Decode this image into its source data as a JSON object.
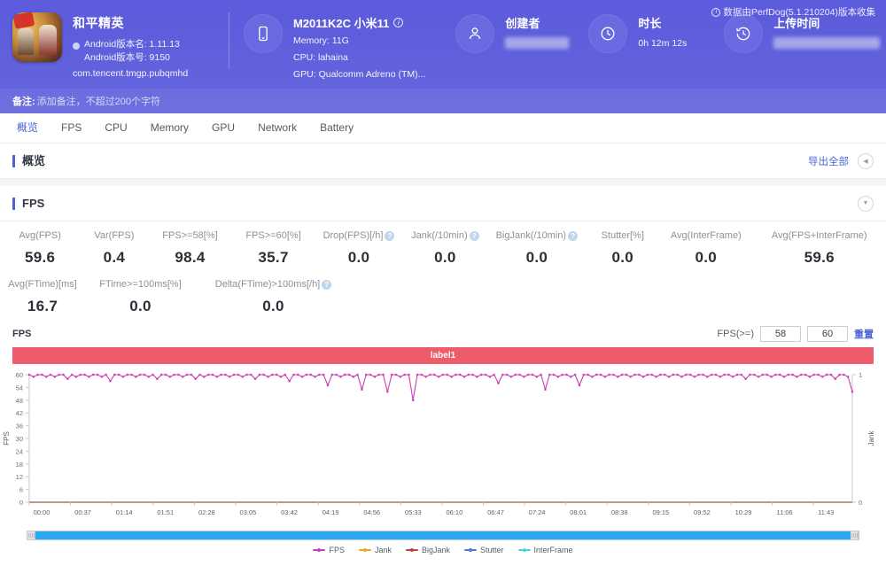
{
  "header": {
    "app": {
      "name": "和平精英",
      "android_version_name_label": "Android版本名: 1.11.13",
      "android_version_code_label": "Android版本号: 9150",
      "package": "com.tencent.tmgp.pubqmhd"
    },
    "device": {
      "model": "M2011K2C 小米11",
      "memory": "Memory: 11G",
      "cpu": "CPU: lahaina",
      "gpu": "GPU: Qualcomm Adreno (TM)..."
    },
    "creator": {
      "label": "创建者",
      "value": ""
    },
    "duration": {
      "label": "时长",
      "value": "0h 12m 12s"
    },
    "upload_time": {
      "label": "上传时间",
      "value": ""
    },
    "perfdog_note": "数据由PerfDog(5.1.210204)版本收集",
    "remark_label": "备注:",
    "remark_placeholder": "添加备注，不超过200个字符"
  },
  "tabs": [
    {
      "label": "概览",
      "active": true
    },
    {
      "label": "FPS",
      "active": false
    },
    {
      "label": "CPU",
      "active": false
    },
    {
      "label": "Memory",
      "active": false
    },
    {
      "label": "GPU",
      "active": false
    },
    {
      "label": "Network",
      "active": false
    },
    {
      "label": "Battery",
      "active": false
    }
  ],
  "overview_section": {
    "title": "概览",
    "export_all": "导出全部",
    "collapse_icon": "chevron-left-icon"
  },
  "fps_section": {
    "title": "FPS",
    "collapse_icon": "chevron-down-icon",
    "metrics_row1": [
      {
        "label": "Avg(FPS)",
        "value": "59.6",
        "help": false
      },
      {
        "label": "Var(FPS)",
        "value": "0.4",
        "help": false
      },
      {
        "label": "FPS>=58[%]",
        "value": "98.4",
        "help": false
      },
      {
        "label": "FPS>=60[%]",
        "value": "35.7",
        "help": false
      },
      {
        "label": "Drop(FPS)[/h]",
        "value": "0.0",
        "help": true
      },
      {
        "label": "Jank(/10min)",
        "value": "0.0",
        "help": true
      },
      {
        "label": "BigJank(/10min)",
        "value": "0.0",
        "help": true
      },
      {
        "label": "Stutter[%]",
        "value": "0.0",
        "help": false
      },
      {
        "label": "Avg(InterFrame)",
        "value": "0.0",
        "help": false
      },
      {
        "label": "Avg(FPS+InterFrame)",
        "value": "59.6",
        "help": false
      }
    ],
    "metrics_row2": [
      {
        "label": "Avg(FTime)[ms]",
        "value": "16.7",
        "help": false
      },
      {
        "label": "FTime>=100ms[%]",
        "value": "0.0",
        "help": false
      },
      {
        "label": "Delta(FTime)>100ms[/h]",
        "value": "0.0",
        "help": true
      }
    ],
    "chart_controls": {
      "chart_name": "FPS",
      "threshold_label": "FPS(>=)",
      "threshold_low": "58",
      "threshold_high": "60",
      "reset_label": "重置"
    },
    "label_band": "label1"
  },
  "chart_data": {
    "type": "line",
    "title": "FPS",
    "xlabel": "",
    "ylabel": "FPS",
    "y2label": "Jank",
    "ylim": [
      0,
      60
    ],
    "y2lim": [
      0,
      1
    ],
    "yticks": [
      0,
      6,
      12,
      18,
      24,
      30,
      36,
      42,
      48,
      54,
      60
    ],
    "y2ticks": [
      0,
      1
    ],
    "grid": false,
    "legend_position": "bottom",
    "xticks": [
      "00:00",
      "00:37",
      "01:14",
      "01:51",
      "02:28",
      "03:05",
      "03:42",
      "04:19",
      "04:56",
      "05:33",
      "06:10",
      "06:47",
      "07:24",
      "08:01",
      "08:38",
      "09:15",
      "09:52",
      "10:29",
      "11:06",
      "11:43"
    ],
    "series": [
      {
        "name": "FPS",
        "color": "#cc3fb0",
        "axis": "left",
        "values": [
          60,
          59,
          60,
          60,
          59,
          60,
          59,
          60,
          60,
          58,
          60,
          59,
          60,
          60,
          59,
          60,
          60,
          59,
          60,
          57,
          60,
          60,
          59,
          60,
          60,
          59,
          60,
          60,
          59,
          60,
          58,
          60,
          60,
          59,
          60,
          60,
          59,
          60,
          60,
          58,
          60,
          59,
          60,
          60,
          59,
          60,
          60,
          59,
          60,
          60,
          59,
          60,
          60,
          58,
          60,
          60,
          59,
          60,
          60,
          59,
          60,
          57,
          60,
          60,
          59,
          60,
          60,
          59,
          60,
          60,
          55,
          60,
          60,
          59,
          60,
          60,
          59,
          60,
          53,
          60,
          60,
          59,
          60,
          60,
          52,
          60,
          60,
          59,
          60,
          60,
          48,
          60,
          60,
          59,
          60,
          60,
          59,
          60,
          60,
          59,
          60,
          60,
          59,
          60,
          60,
          59,
          60,
          60,
          59,
          60,
          56,
          60,
          60,
          59,
          60,
          60,
          59,
          60,
          60,
          59,
          60,
          53,
          60,
          60,
          59,
          60,
          60,
          59,
          60,
          55,
          60,
          60,
          59,
          60,
          60,
          59,
          60,
          60,
          59,
          60,
          60,
          59,
          60,
          60,
          59,
          60,
          60,
          59,
          60,
          60,
          59,
          60,
          60,
          59,
          60,
          60,
          59,
          60,
          60,
          59,
          60,
          60,
          59,
          60,
          60,
          59,
          60,
          60,
          58,
          60,
          60,
          59,
          60,
          60,
          59,
          60,
          60,
          59,
          60,
          60,
          59,
          60,
          60,
          59,
          60,
          60,
          59,
          60,
          60,
          58,
          60,
          60,
          59,
          52
        ]
      },
      {
        "name": "Jank",
        "color": "#f0a030",
        "axis": "right",
        "values": []
      },
      {
        "name": "BigJank",
        "color": "#c43c4a",
        "axis": "right",
        "values": []
      },
      {
        "name": "Stutter",
        "color": "#4a79d8",
        "axis": "right",
        "values": []
      },
      {
        "name": "InterFrame",
        "color": "#4fd2d2",
        "axis": "right",
        "values": []
      }
    ],
    "legend": [
      {
        "name": "FPS",
        "color": "#cc3fb0"
      },
      {
        "name": "Jank",
        "color": "#f0a030"
      },
      {
        "name": "BigJank",
        "color": "#c43c4a"
      },
      {
        "name": "Stutter",
        "color": "#4a79d8"
      },
      {
        "name": "InterFrame",
        "color": "#4fd2d2"
      }
    ]
  },
  "colors": {
    "header_bg": "#5b5bdc",
    "accent": "#4b63d8",
    "label_band": "#ec5c6b",
    "scrollbar": "#29a8f0"
  }
}
